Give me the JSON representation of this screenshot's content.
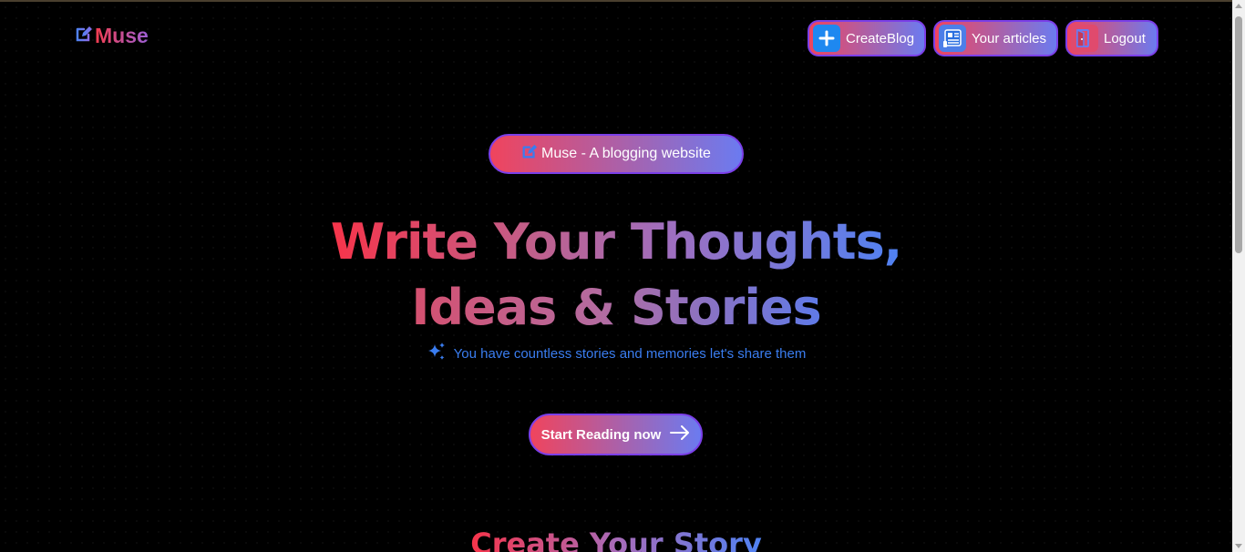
{
  "brand": {
    "name": "Muse",
    "icon": "pen-square-icon"
  },
  "nav": {
    "create": {
      "label": "CreateBlog",
      "icon": "plus-icon"
    },
    "articles": {
      "label": "Your articles",
      "icon": "newspaper-icon"
    },
    "logout": {
      "label": "Logout",
      "icon": "logout-door-icon"
    }
  },
  "hero": {
    "pill": "Muse - A blogging website",
    "headline_line1": "Write Your Thoughts,",
    "headline_line2": "Ideas & Stories",
    "tagline": "You have countless stories and memories let's share them",
    "cta": "Start Reading now"
  },
  "section": {
    "title": "Create Your Story"
  },
  "colors": {
    "background": "#000000",
    "gradient_start": "#f0445d",
    "gradient_end": "#6b7bf0",
    "border": "#7b3fe8",
    "tagline": "#3a7df0"
  }
}
